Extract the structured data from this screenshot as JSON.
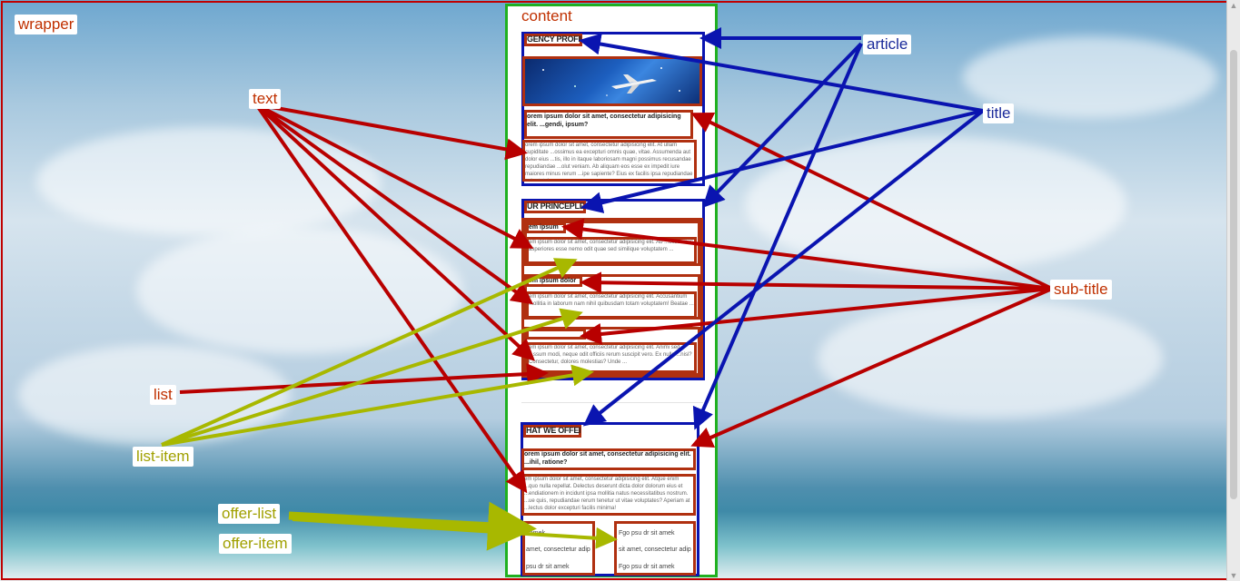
{
  "labels": {
    "wrapper": "wrapper",
    "content": "content",
    "article": "article",
    "title": "title",
    "text": "text",
    "sub_title": "sub-title",
    "list": "list",
    "list_item": "list-item",
    "offer_list": "offer-list",
    "offer_item": "offer-item"
  },
  "page": {
    "agency_profile": "GENCY PROFILE",
    "profile_lead": "orem ipsum dolor sit amet, consectetur adipisicing elit. ...gendi, ipsum?",
    "profile_text": "orem ipsum dolor sit amet, consectetur adipisicing elit. At ullam cupiditate ...ossimus ea excepturi omnis quae, vitae. Assumenda aut dolor eius ...tis, illo in itaque laboriosam magni possimus recusandae repudiandae ...olut veniam. Ab aliquam eos esse ex impedit iure maiores minus rerum ...ipe sapiente? Eius ex facilis ipsa repudiandae voluptate!",
    "principles": "UR PRINCEPLES",
    "principle_1_title": "em ipsum",
    "principle_1_text": "em ipsum dolor sit amet, consectetur adipisicing elit. Ab ...ccusamus asperiores esse nemo odit quae sed similique voluptatem ...",
    "principle_2_title": "em ipsum dolor",
    "principle_2_text": "em ipsum dolor sit amet, consectetur adipisicing elit. Accusantium ...ollitia in laborum nam nihil quibusdam totam voluptatem! Beatae ...",
    "principle_3_title": "",
    "principle_3_text": "em ipsum dolor sit amet, consectetur adipisicing elit. Animi sed ...ssum modi, neque odit officiis rerum suscipit vero. Ex nulla ...nisi? Consectetur, dolores molestias? Unde ...",
    "offer": "HAT WE OFFER",
    "offer_lead": "orem ipsum dolor sit amet, consectetur adipisicing elit. ...ihil, ratione?",
    "offer_text": "em ipsum dolor sit amet, consectetur adipisicing elit. Atque enim ...quo nulla repellat. Delectus deserunt dicta dolor dolorum eius et ...endiationem in incidunt ipsa mollitia natus necessitatibus nostrum. ...ue quis, repudiandae rerum tenetur ut vitae voluptates? Aperiam at ...lectus dolor excepturi facilis minima!",
    "offer_item_1": [
      "t amek",
      "amet, consectetur adip",
      "psu dr sit amek"
    ],
    "offer_item_2": [
      "Fgo psu dr sit amek",
      "sit amet, consectetur adip",
      "Fgo psu dr sit amek"
    ]
  },
  "colors": {
    "wrapper_border": "#c00000",
    "content_border": "#20b020",
    "article_arrow": "#0a14b0",
    "text_arrow": "#b80000",
    "list_item_arrow": "#a8b800"
  }
}
